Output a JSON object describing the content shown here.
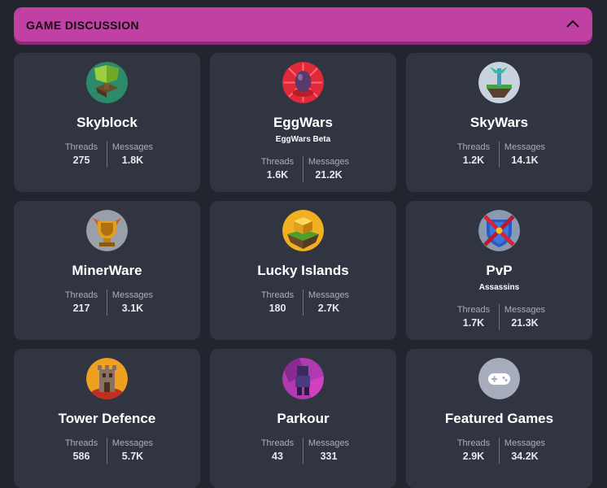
{
  "header": {
    "title": "GAME DISCUSSION"
  },
  "labels": {
    "threads": "Threads",
    "messages": "Messages"
  },
  "cards": [
    {
      "name": "Skyblock",
      "subtitle": "",
      "threads": "275",
      "messages": "1.8K",
      "icon": "skyblock-icon"
    },
    {
      "name": "EggWars",
      "subtitle": "EggWars Beta",
      "threads": "1.6K",
      "messages": "21.2K",
      "icon": "eggwars-icon"
    },
    {
      "name": "SkyWars",
      "subtitle": "",
      "threads": "1.2K",
      "messages": "14.1K",
      "icon": "skywars-icon"
    },
    {
      "name": "MinerWare",
      "subtitle": "",
      "threads": "217",
      "messages": "3.1K",
      "icon": "minerware-icon"
    },
    {
      "name": "Lucky Islands",
      "subtitle": "",
      "threads": "180",
      "messages": "2.7K",
      "icon": "lucky-islands-icon"
    },
    {
      "name": "PvP",
      "subtitle": "Assassins",
      "threads": "1.7K",
      "messages": "21.3K",
      "icon": "pvp-icon"
    },
    {
      "name": "Tower Defence",
      "subtitle": "",
      "threads": "586",
      "messages": "5.7K",
      "icon": "tower-defence-icon"
    },
    {
      "name": "Parkour",
      "subtitle": "",
      "threads": "43",
      "messages": "331",
      "icon": "parkour-icon"
    },
    {
      "name": "Featured Games",
      "subtitle": "",
      "threads": "2.9K",
      "messages": "34.2K",
      "icon": "gamepad-icon"
    }
  ],
  "colors": {
    "accent": "#c040a4",
    "card": "#313541",
    "background": "#22252d"
  }
}
